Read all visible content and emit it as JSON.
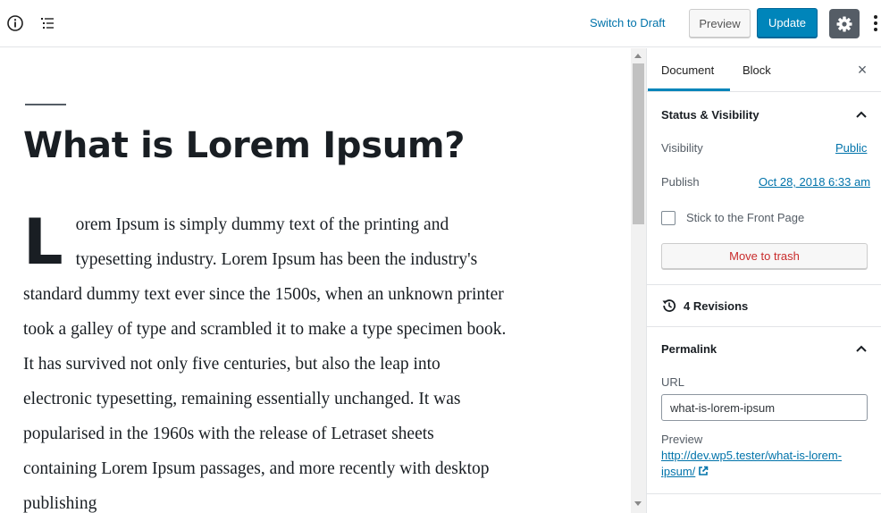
{
  "toolbar": {
    "switch_to_draft": "Switch to Draft",
    "preview": "Preview",
    "update": "Update"
  },
  "editor": {
    "title": "What is Lorem Ipsum?",
    "dropcap": "L",
    "body": "orem Ipsum is simply dummy text of the printing and typesetting industry. Lorem Ipsum has been the industry's standard dummy text ever since the 1500s, when an unknown printer took a galley of type and scrambled it to make a type specimen book. It has survived not only five centuries, but also the leap into electronic typesetting, remaining essentially unchanged. It was popularised in the 1960s with the release of Letraset sheets containing Lorem Ipsum passages, and more recently with desktop publishing"
  },
  "sidebar": {
    "tabs": {
      "document": "Document",
      "block": "Block"
    },
    "close": "×",
    "status": {
      "heading": "Status & Visibility",
      "visibility_label": "Visibility",
      "visibility_value": "Public",
      "publish_label": "Publish",
      "publish_value": "Oct 28, 2018 6:33 am",
      "stick_label": "Stick to the Front Page",
      "move_to_trash": "Move to trash"
    },
    "revisions": {
      "label": "4 Revisions"
    },
    "permalink": {
      "heading": "Permalink",
      "url_label": "URL",
      "url_value": "what-is-lorem-ipsum",
      "preview_label": "Preview",
      "preview_link": "http://dev.wp5.tester/what-is-lorem-ipsum/"
    }
  },
  "colors": {
    "accent": "#0085ba",
    "link": "#0073aa",
    "danger": "#c92c2c",
    "settings_bg": "#555d66"
  },
  "icons": [
    "info-icon",
    "outline-icon",
    "gear-icon",
    "more-icon",
    "close-icon",
    "chevron-up-icon",
    "history-icon",
    "external-link-icon"
  ]
}
